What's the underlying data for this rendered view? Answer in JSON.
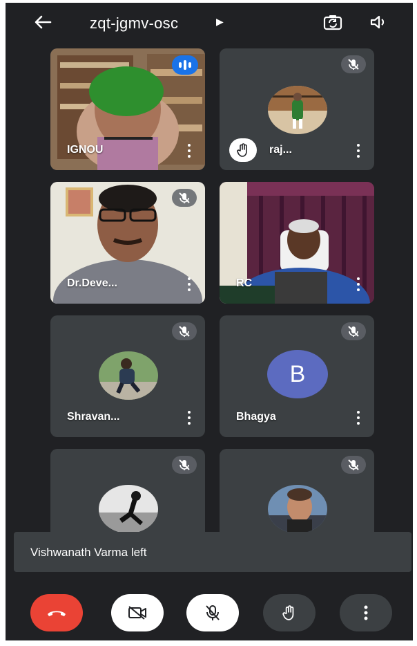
{
  "meeting": {
    "code": "zqt-jgmv-osc"
  },
  "participants": [
    {
      "name": "IGNOU"
    },
    {
      "name": "raj..."
    },
    {
      "name": "Dr.Deve..."
    },
    {
      "name": "RC"
    },
    {
      "name": "Shravan..."
    },
    {
      "name": "Bhagya",
      "avatar_letter": "B"
    },
    {
      "name": ""
    },
    {
      "name": ""
    }
  ],
  "notification": {
    "text": "Vishwanath Varma left"
  },
  "colors": {
    "background": "#202124",
    "tile": "#3c4043",
    "end_call": "#ea4335",
    "speaking": "#1a73e8",
    "avatar_b": "#5c6bc0"
  },
  "icons": {
    "back": "arrow-left-icon",
    "title_expand": "caret-right-icon",
    "flip_camera": "camera-flip-icon",
    "audio": "speaker-icon",
    "muted": "mic-off-icon",
    "speaking": "audio-level-icon",
    "raised_hand": "hand-icon",
    "more": "more-vert-icon",
    "end_call": "phone-hangup-icon",
    "camera_off": "videocam-off-icon"
  }
}
